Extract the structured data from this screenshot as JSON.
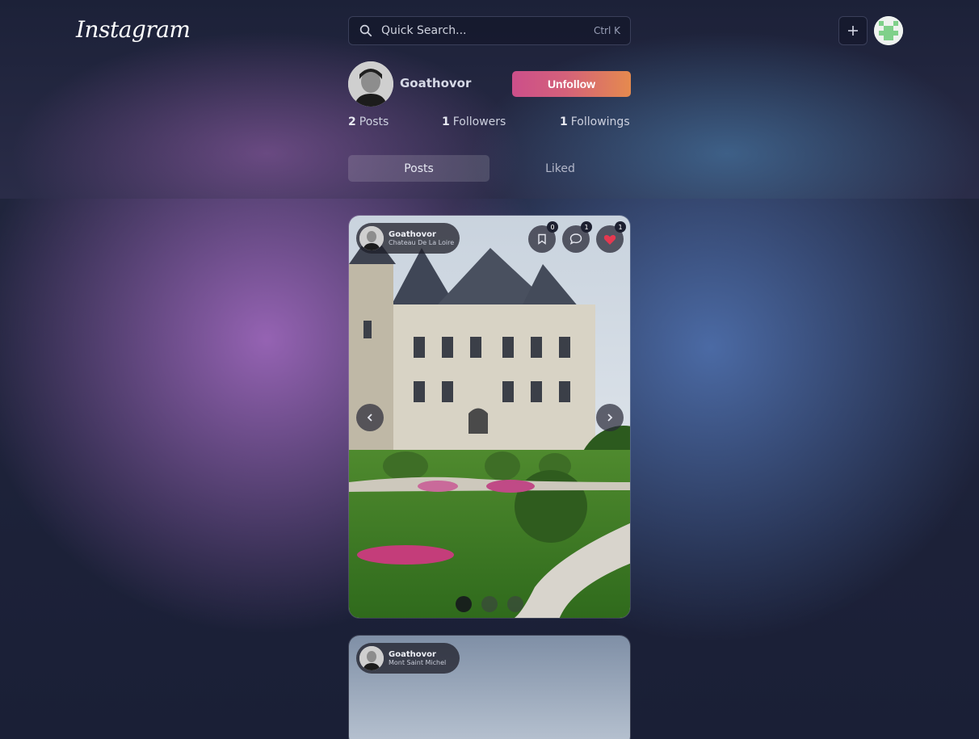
{
  "app": {
    "logo_text": "Instagram"
  },
  "search": {
    "placeholder": "Quick Search...",
    "shortcut": "Ctrl K"
  },
  "header": {
    "add_icon": "plus-icon"
  },
  "profile": {
    "username": "Goathovor",
    "action_label": "Unfollow",
    "stats": [
      {
        "count": "2",
        "label": "Posts"
      },
      {
        "count": "1",
        "label": "Followers"
      },
      {
        "count": "1",
        "label": "Followings"
      }
    ],
    "tabs": [
      {
        "label": "Posts",
        "active": true
      },
      {
        "label": "Liked",
        "active": false
      }
    ]
  },
  "posts": [
    {
      "author": "Goathovor",
      "location": "Chateau De La Loire",
      "saves": "0",
      "comments": "1",
      "likes": "1",
      "liked": true,
      "slides": 3,
      "current_slide": 1
    },
    {
      "author": "Goathovor",
      "location": "Mont Saint Michel"
    }
  ],
  "colors": {
    "like_red": "#e53950",
    "accent_start": "#cc4f8a",
    "accent_end": "#e58a4e"
  }
}
